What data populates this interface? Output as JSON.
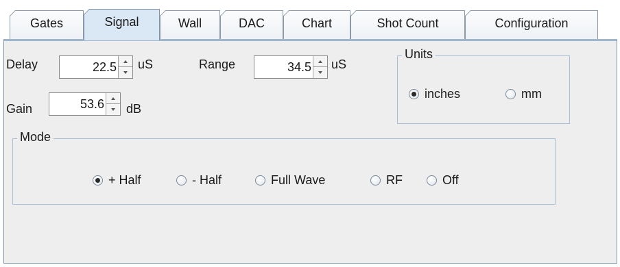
{
  "tabs": [
    {
      "label": "Gates",
      "selected": false
    },
    {
      "label": "Signal",
      "selected": true
    },
    {
      "label": "Wall",
      "selected": false
    },
    {
      "label": "DAC",
      "selected": false
    },
    {
      "label": "Chart",
      "selected": false
    },
    {
      "label": "Shot Count",
      "selected": false
    },
    {
      "label": "Configuration",
      "selected": false
    }
  ],
  "signal": {
    "delay": {
      "label": "Delay",
      "value": "22.5",
      "unit": "uS"
    },
    "range": {
      "label": "Range",
      "value": "34.5",
      "unit": "uS"
    },
    "gain": {
      "label": "Gain",
      "value": "53.6",
      "unit": "dB"
    },
    "units": {
      "title": "Units",
      "options": [
        {
          "label": "inches",
          "selected": true
        },
        {
          "label": "mm",
          "selected": false
        }
      ]
    },
    "mode": {
      "title": "Mode",
      "options": [
        {
          "label": "+ Half",
          "selected": true
        },
        {
          "label": "- Half",
          "selected": false
        },
        {
          "label": "Full Wave",
          "selected": false
        },
        {
          "label": "RF",
          "selected": false
        },
        {
          "label": "Off",
          "selected": false
        }
      ]
    }
  },
  "colors": {
    "selected_tab": "#dae7f5",
    "panel_background": "#eeeeee",
    "panel_border": "#7e95ad",
    "groupbox_border": "#a9bfd6"
  }
}
